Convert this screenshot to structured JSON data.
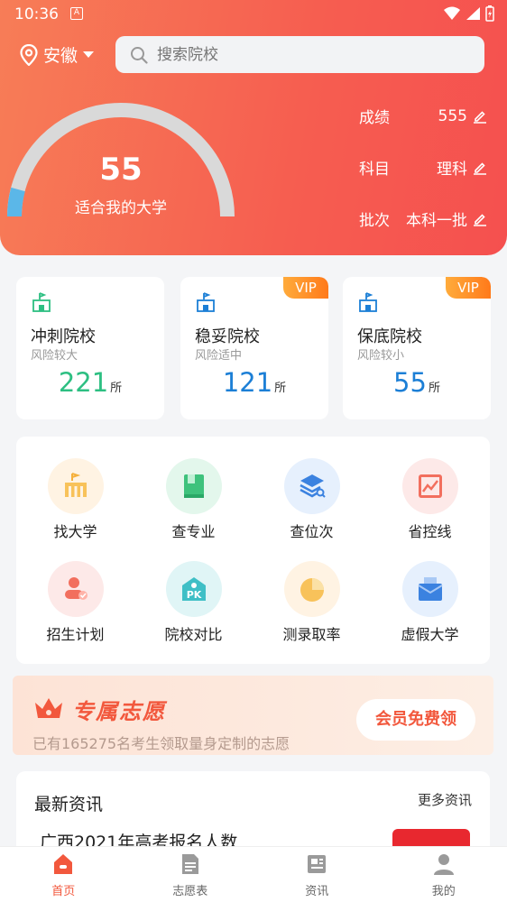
{
  "status": {
    "time": "10:36",
    "notif": "A"
  },
  "header": {
    "location": "安徽",
    "search_placeholder": "搜索院校",
    "gauge": {
      "value": "55",
      "label": "适合我的大学",
      "fill_fraction": 0.03
    },
    "info": [
      {
        "key": "成绩",
        "value": "555"
      },
      {
        "key": "科目",
        "value": "理科"
      },
      {
        "key": "批次",
        "value": "本科一批"
      }
    ]
  },
  "cards": [
    {
      "title": "冲刺院校",
      "sub": "风险较大",
      "count": "221",
      "unit": "所",
      "color": "#2dbf82",
      "vip": ""
    },
    {
      "title": "稳妥院校",
      "sub": "风险适中",
      "count": "121",
      "unit": "所",
      "color": "#1c7fd6",
      "vip": "VIP"
    },
    {
      "title": "保底院校",
      "sub": "风险较小",
      "count": "55",
      "unit": "所",
      "color": "#1c7fd6",
      "vip": "VIP"
    }
  ],
  "tools": [
    {
      "label": "找大学",
      "icon": "university-icon",
      "bg": "#fff3e3"
    },
    {
      "label": "查专业",
      "icon": "book-icon",
      "bg": "#e3f7ec"
    },
    {
      "label": "查位次",
      "icon": "layers-search-icon",
      "bg": "#e6f0fd"
    },
    {
      "label": "省控线",
      "icon": "line-chart-icon",
      "bg": "#fde9e8"
    },
    {
      "label": "招生计划",
      "icon": "user-plan-icon",
      "bg": "#fde9e8"
    },
    {
      "label": "院校对比",
      "icon": "pk-icon",
      "bg": "#e0f5f6"
    },
    {
      "label": "测录取率",
      "icon": "pie-chart-icon",
      "bg": "#fff3e3"
    },
    {
      "label": "虚假大学",
      "icon": "envelope-icon",
      "bg": "#e6f0fd"
    }
  ],
  "banner": {
    "title": "专属志愿",
    "subtitle": "已有165275名考生领取量身定制的志愿",
    "button": "会员免费领"
  },
  "news": {
    "heading": "最新资讯",
    "more": "更多资讯",
    "first_item": "广西2021年高考报名人数"
  },
  "tabs": [
    {
      "label": "首页",
      "icon": "home-icon",
      "active": true
    },
    {
      "label": "志愿表",
      "icon": "document-icon",
      "active": false
    },
    {
      "label": "资讯",
      "icon": "news-icon",
      "active": false
    },
    {
      "label": "我的",
      "icon": "profile-icon",
      "active": false
    }
  ],
  "colors": {
    "accent": "#f2583d",
    "hero_start": "#f77d57",
    "hero_end": "#f5504f"
  }
}
